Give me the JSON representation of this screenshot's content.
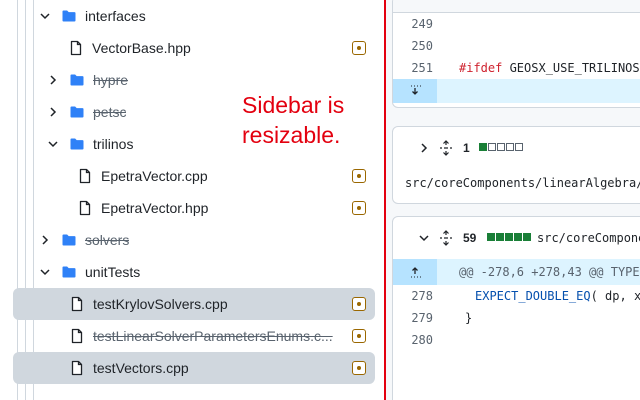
{
  "sidebar": {
    "rows": [
      {
        "label": "interfaces",
        "type": "folder",
        "expanded": true,
        "strike": false,
        "selected": false,
        "diff_icon": false
      },
      {
        "label": "VectorBase.hpp",
        "type": "file",
        "strike": false,
        "selected": false,
        "diff_icon": true
      },
      {
        "label": "hypre",
        "type": "folder",
        "expanded": false,
        "strike": true,
        "selected": false,
        "diff_icon": false
      },
      {
        "label": "petsc",
        "type": "folder",
        "expanded": false,
        "strike": true,
        "selected": false,
        "diff_icon": false
      },
      {
        "label": "trilinos",
        "type": "folder",
        "expanded": true,
        "strike": false,
        "selected": false,
        "diff_icon": false
      },
      {
        "label": "EpetraVector.cpp",
        "type": "file",
        "strike": false,
        "selected": false,
        "diff_icon": true
      },
      {
        "label": "EpetraVector.hpp",
        "type": "file",
        "strike": false,
        "selected": false,
        "diff_icon": true
      },
      {
        "label": "solvers",
        "type": "folder",
        "expanded": false,
        "strike": true,
        "selected": false,
        "diff_icon": false
      },
      {
        "label": "unitTests",
        "type": "folder",
        "expanded": true,
        "strike": false,
        "selected": false,
        "diff_icon": false
      },
      {
        "label": "testKrylovSolvers.cpp",
        "type": "file",
        "strike": false,
        "selected": true,
        "diff_icon": true
      },
      {
        "label": "testLinearSolverParametersEnums.c...",
        "type": "file",
        "strike": true,
        "selected": false,
        "diff_icon": true
      },
      {
        "label": "testVectors.cpp",
        "type": "file",
        "strike": false,
        "selected": true,
        "diff_icon": true
      }
    ]
  },
  "annotation": {
    "text": "Sidebar is resizable."
  },
  "diff": {
    "card1": {
      "lines": [
        {
          "num": "249",
          "code": ""
        },
        {
          "num": "250",
          "code": ""
        },
        {
          "num": "251",
          "keyword": "#ifdef",
          "code": " GEOSX_USE_TRILINOS"
        }
      ]
    },
    "card2": {
      "count": "1",
      "blocks": [
        true,
        false,
        false,
        false,
        false
      ],
      "path": "src/coreComponents/linearAlgebra/u"
    },
    "card3": {
      "count": "59",
      "blocks": [
        true,
        true,
        true,
        true,
        true
      ],
      "path": "src/coreCompone",
      "hunk": "@@ -278,6 +278,43 @@ TYPED",
      "lines": [
        {
          "num": "278",
          "fn": "EXPECT_DOUBLE_EQ",
          "code": "( dp, x"
        },
        {
          "num": "279",
          "code": "}"
        },
        {
          "num": "280",
          "code": ""
        }
      ]
    }
  },
  "colors": {
    "accent_red": "#e3000f",
    "folder_blue": "#2f81f7",
    "added_green": "#1a7f37",
    "modified_yellow": "#9a6700"
  }
}
